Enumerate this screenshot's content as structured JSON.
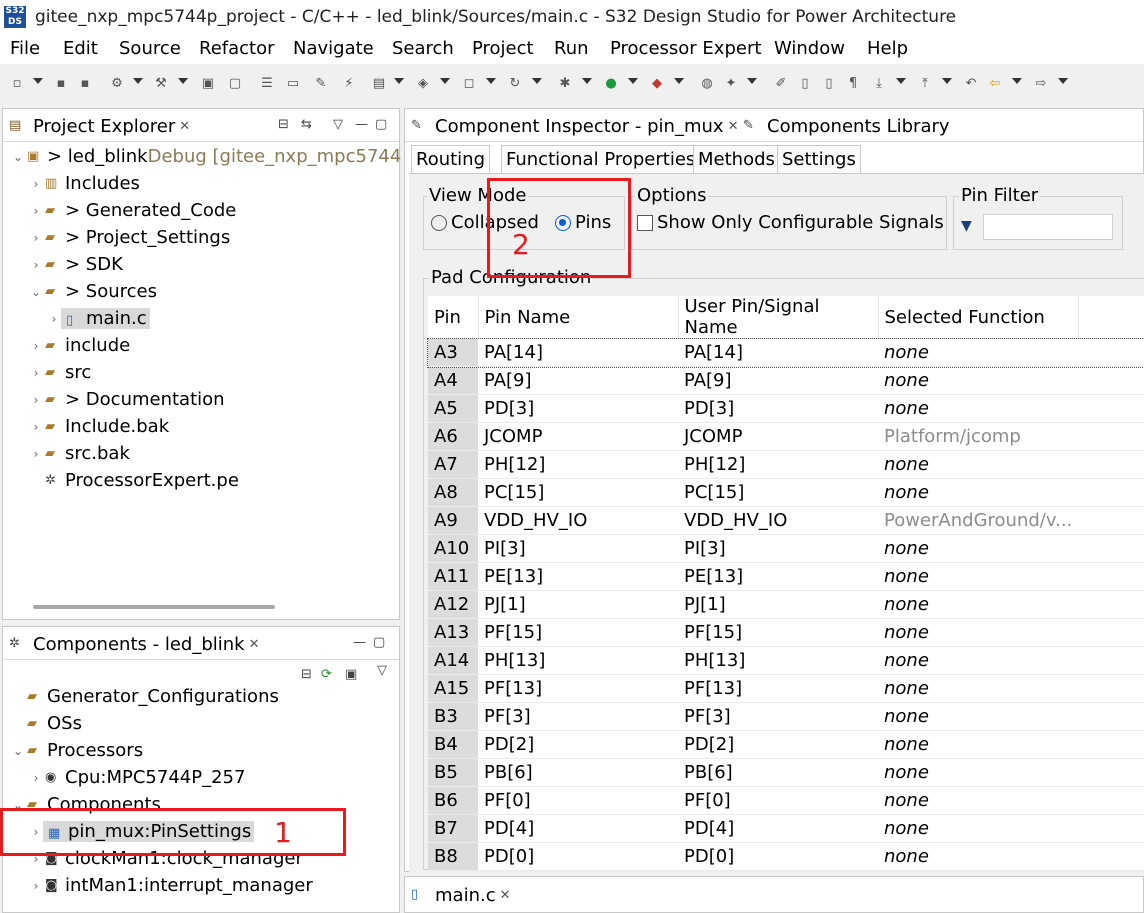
{
  "window": {
    "title": "gitee_nxp_mpc5744p_project - C/C++ - led_blink/Sources/main.c - S32 Design Studio for Power Architecture",
    "app_icon_text": "S32\nDS"
  },
  "menu": [
    "File",
    "Edit",
    "Source",
    "Refactor",
    "Navigate",
    "Search",
    "Project",
    "Run",
    "Processor Expert",
    "Window",
    "Help"
  ],
  "project_explorer": {
    "title": "Project Explorer",
    "items": [
      {
        "label": "> led_blink",
        "suffix": " Debug [gitee_nxp_mpc5744"
      },
      {
        "label": "Includes"
      },
      {
        "label": "> Generated_Code"
      },
      {
        "label": "> Project_Settings"
      },
      {
        "label": "> SDK"
      },
      {
        "label": "> Sources"
      },
      {
        "label": "main.c"
      },
      {
        "label": "include"
      },
      {
        "label": "src"
      },
      {
        "label": "> Documentation"
      },
      {
        "label": "Include.bak"
      },
      {
        "label": "src.bak"
      },
      {
        "label": "ProcessorExpert.pe"
      }
    ]
  },
  "components_view": {
    "title": "Components - led_blink",
    "items": [
      {
        "label": "Generator_Configurations"
      },
      {
        "label": "OSs"
      },
      {
        "label": "Processors"
      },
      {
        "label": "Cpu:MPC5744P_257"
      },
      {
        "label": "Components"
      },
      {
        "label": "pin_mux:PinSettings"
      },
      {
        "label": "clockMan1:clock_manager"
      },
      {
        "label": "intMan1:interrupt_manager"
      }
    ]
  },
  "inspector": {
    "tab_title": "Component Inspector - pin_mux",
    "library_tab": "Components Library",
    "subtabs": [
      "Routing",
      "Functional Properties",
      "Methods",
      "Settings"
    ],
    "view_mode": {
      "label": "View Mode",
      "collapsed": "Collapsed",
      "pins": "Pins",
      "selected": "Pins"
    },
    "options": {
      "label": "Options",
      "checkbox": "Show Only Configurable Signals"
    },
    "pin_filter": {
      "label": "Pin Filter",
      "value": ""
    },
    "pad_config_label": "Pad Configuration",
    "columns": [
      "Pin",
      "Pin Name",
      "User Pin/Signal Name",
      "Selected Function"
    ],
    "rows": [
      [
        "A3",
        "PA[14]",
        "PA[14]",
        "none"
      ],
      [
        "A4",
        "PA[9]",
        "PA[9]",
        "none"
      ],
      [
        "A5",
        "PD[3]",
        "PD[3]",
        "none"
      ],
      [
        "A6",
        "JCOMP",
        "JCOMP",
        "Platform/jcomp"
      ],
      [
        "A7",
        "PH[12]",
        "PH[12]",
        "none"
      ],
      [
        "A8",
        "PC[15]",
        "PC[15]",
        "none"
      ],
      [
        "A9",
        "VDD_HV_IO",
        "VDD_HV_IO",
        "PowerAndGround/v..."
      ],
      [
        "A10",
        "PI[3]",
        "PI[3]",
        "none"
      ],
      [
        "A11",
        "PE[13]",
        "PE[13]",
        "none"
      ],
      [
        "A12",
        "PJ[1]",
        "PJ[1]",
        "none"
      ],
      [
        "A13",
        "PF[15]",
        "PF[15]",
        "none"
      ],
      [
        "A14",
        "PH[13]",
        "PH[13]",
        "none"
      ],
      [
        "A15",
        "PF[13]",
        "PF[13]",
        "none"
      ],
      [
        "B3",
        "PF[3]",
        "PF[3]",
        "none"
      ],
      [
        "B4",
        "PD[2]",
        "PD[2]",
        "none"
      ],
      [
        "B5",
        "PB[6]",
        "PB[6]",
        "none"
      ],
      [
        "B6",
        "PF[0]",
        "PF[0]",
        "none"
      ],
      [
        "B7",
        "PD[4]",
        "PD[4]",
        "none"
      ],
      [
        "B8",
        "PD[0]",
        "PD[0]",
        "none"
      ]
    ]
  },
  "editor_tab": "main.c",
  "annotations": {
    "one": "1",
    "two": "2"
  }
}
